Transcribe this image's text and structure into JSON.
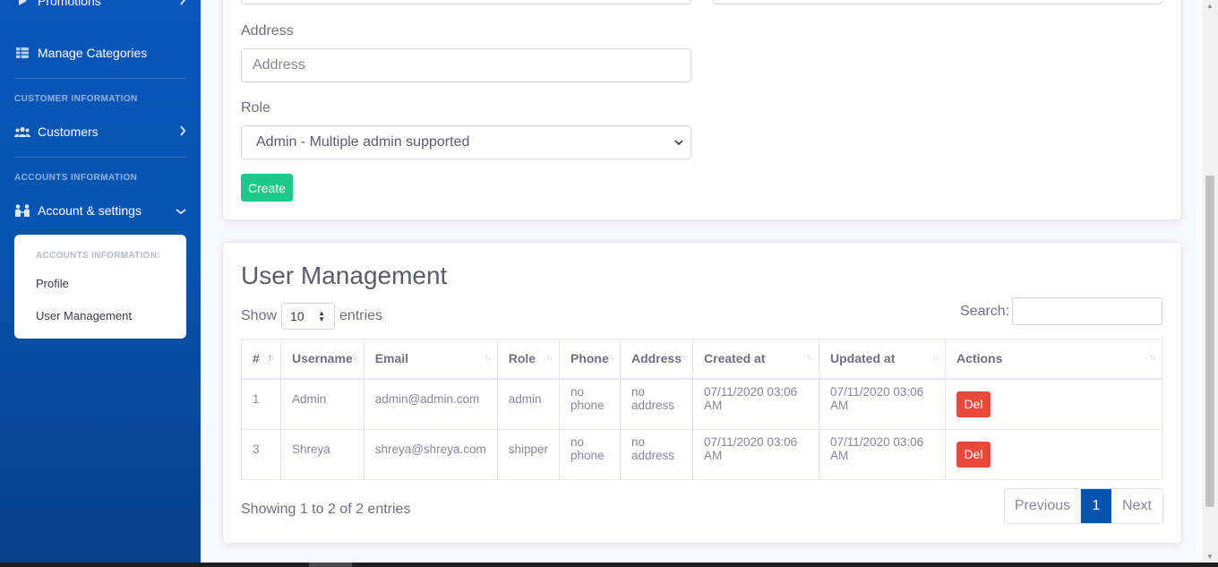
{
  "sidebar": {
    "promotions": "Promotions",
    "manage_categories": "Manage Categories",
    "heading_customer": "CUSTOMER INFORMATION",
    "customers": "Customers",
    "heading_accounts": "ACCOUNTS INFORMATION",
    "account_settings": "Account & settings",
    "submenu": {
      "heading": "ACCOUNTS INFORMATION:",
      "profile": "Profile",
      "user_management": "User Management"
    }
  },
  "form": {
    "address_label": "Address",
    "address_placeholder": "Address",
    "role_label": "Role",
    "role_selected": "Admin - Multiple admin supported",
    "create_button": "Create"
  },
  "user_management": {
    "title": "User Management",
    "show_label": "Show",
    "page_length": "10",
    "entries_label": "entries",
    "search_label": "Search:",
    "search_value": "",
    "columns": [
      "#",
      "Username",
      "Email",
      "Role",
      "Phone",
      "Address",
      "Created at",
      "Updated at",
      "Actions"
    ],
    "rows": [
      {
        "id": "1",
        "username": "Admin",
        "email": "admin@admin.com",
        "role": "admin",
        "phone": "no phone",
        "address": "no address",
        "created": "07/11/2020 03:06 AM",
        "updated": "07/11/2020 03:06 AM",
        "action": "Del"
      },
      {
        "id": "3",
        "username": "Shreya",
        "email": "shreya@shreya.com",
        "role": "shipper",
        "phone": "no phone",
        "address": "no address",
        "created": "07/11/2020 03:06 AM",
        "updated": "07/11/2020 03:06 AM",
        "action": "Del"
      }
    ],
    "info": "Showing 1 to 2 of 2 entries",
    "pagination": {
      "previous": "Previous",
      "current": "1",
      "next": "Next"
    }
  },
  "colors": {
    "sidebar_blue": "#0753b0",
    "create_green": "#1cc88a",
    "delete_red": "#e74a3b",
    "page_active": "#0753b0"
  }
}
